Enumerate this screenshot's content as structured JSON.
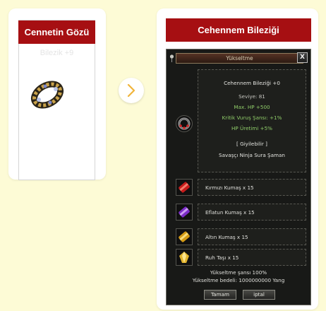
{
  "source_item": {
    "title": "Cennetin Gözü",
    "subtitle": "Bilezik +9",
    "icon": "bracelet-icon"
  },
  "arrow": {
    "icon": "chevron-right-icon"
  },
  "target_item": {
    "title": "Cehennem Bileziği"
  },
  "window": {
    "caption": "Yükseltme",
    "close_label": "X",
    "item_name": "Cehennem Bileziği +0",
    "level": "Seviye: 81",
    "stats": [
      "Max. HP +500",
      "Kritik Vuruş Şansı: +1%",
      "HP Üretimi +5%"
    ],
    "wearable": "[ Giyilebilir ]",
    "classes": "Savaşçı Ninja Sura Şaman",
    "materials": [
      {
        "label": "Kırmızı Kumaş x 15",
        "icon": "red-cloth-icon"
      },
      {
        "label": "Eflatun Kumaş x 15",
        "icon": "purple-cloth-icon"
      },
      {
        "label": "Altın Kumaş x 15",
        "icon": "gold-cloth-icon"
      },
      {
        "label": "Ruh Taşı x 15",
        "icon": "soul-stone-icon"
      }
    ],
    "chance": "Yükseltme şansı 100%",
    "cost": "Yükseltme bedeli: 1000000000 Yang",
    "ok_label": "Tamam",
    "cancel_label": "iptal"
  },
  "colors": {
    "page_background": "#fdfbd6",
    "title_bar": "#a60f12",
    "window_background": "#181917",
    "stat_green": "#8fcc69"
  }
}
